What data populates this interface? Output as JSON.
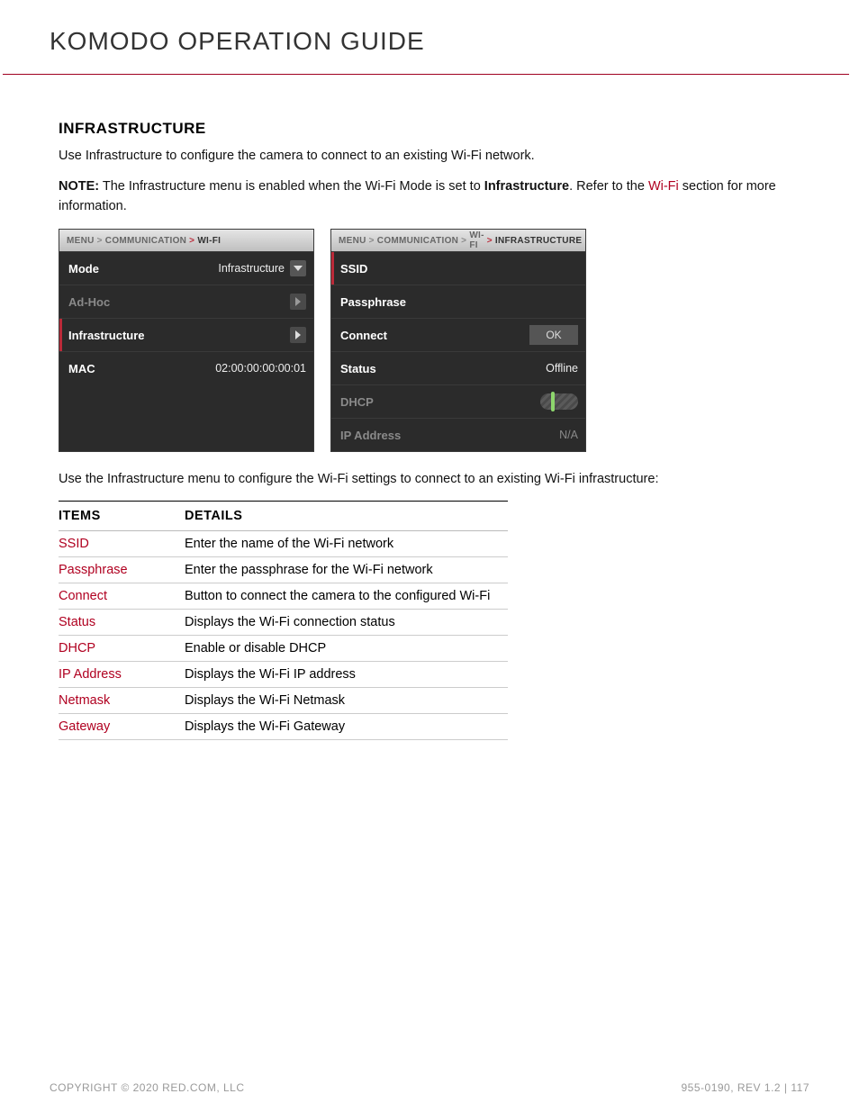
{
  "header": {
    "title": "KOMODO OPERATION GUIDE"
  },
  "section": {
    "heading": "INFRASTRUCTURE",
    "intro": "Use Infrastructure to configure the camera to connect to an existing Wi-Fi network.",
    "note_label": "NOTE:",
    "note_text_a": " The Infrastructure menu is enabled when the Wi-Fi Mode is set to ",
    "note_bold": "Infrastructure",
    "note_text_b": ". Refer to the ",
    "note_link": "Wi-Fi",
    "note_text_c": " section for more information.",
    "post_panels": "Use the Infrastructure menu to configure the Wi-Fi settings to connect to an existing Wi-Fi infrastructure:"
  },
  "panel1": {
    "crumbs": {
      "a": "MENU",
      "b": "COMMUNICATION",
      "c": "WI-FI"
    },
    "rows": {
      "mode_label": "Mode",
      "mode_value": "Infrastructure",
      "adhoc_label": "Ad-Hoc",
      "infra_label": "Infrastructure",
      "mac_label": "MAC",
      "mac_value": "02:00:00:00:00:01"
    }
  },
  "panel2": {
    "crumbs": {
      "a": "MENU",
      "b": "COMMUNICATION",
      "c": "WI-FI",
      "d": "INFRASTRUCTURE"
    },
    "rows": {
      "ssid_label": "SSID",
      "pass_label": "Passphrase",
      "connect_label": "Connect",
      "connect_btn": "OK",
      "status_label": "Status",
      "status_value": "Offline",
      "dhcp_label": "DHCP",
      "ip_label": "IP Address",
      "ip_value": "N/A"
    }
  },
  "table": {
    "head_items": "ITEMS",
    "head_details": "DETAILS",
    "rows": [
      {
        "item": "SSID",
        "detail": "Enter the name of the Wi-Fi network"
      },
      {
        "item": "Passphrase",
        "detail": "Enter the passphrase for the Wi-Fi network"
      },
      {
        "item": "Connect",
        "detail": "Button to connect the camera to the configured Wi-Fi"
      },
      {
        "item": "Status",
        "detail": "Displays the Wi-Fi connection status"
      },
      {
        "item": "DHCP",
        "detail": "Enable or disable DHCP"
      },
      {
        "item": "IP Address",
        "detail": "Displays the Wi-Fi IP address"
      },
      {
        "item": "Netmask",
        "detail": "Displays the Wi-Fi Netmask"
      },
      {
        "item": "Gateway",
        "detail": "Displays the Wi-Fi Gateway"
      }
    ]
  },
  "footer": {
    "copyright": "COPYRIGHT © 2020 RED.COM, LLC",
    "docinfo": "955-0190, REV 1.2  |  117"
  }
}
